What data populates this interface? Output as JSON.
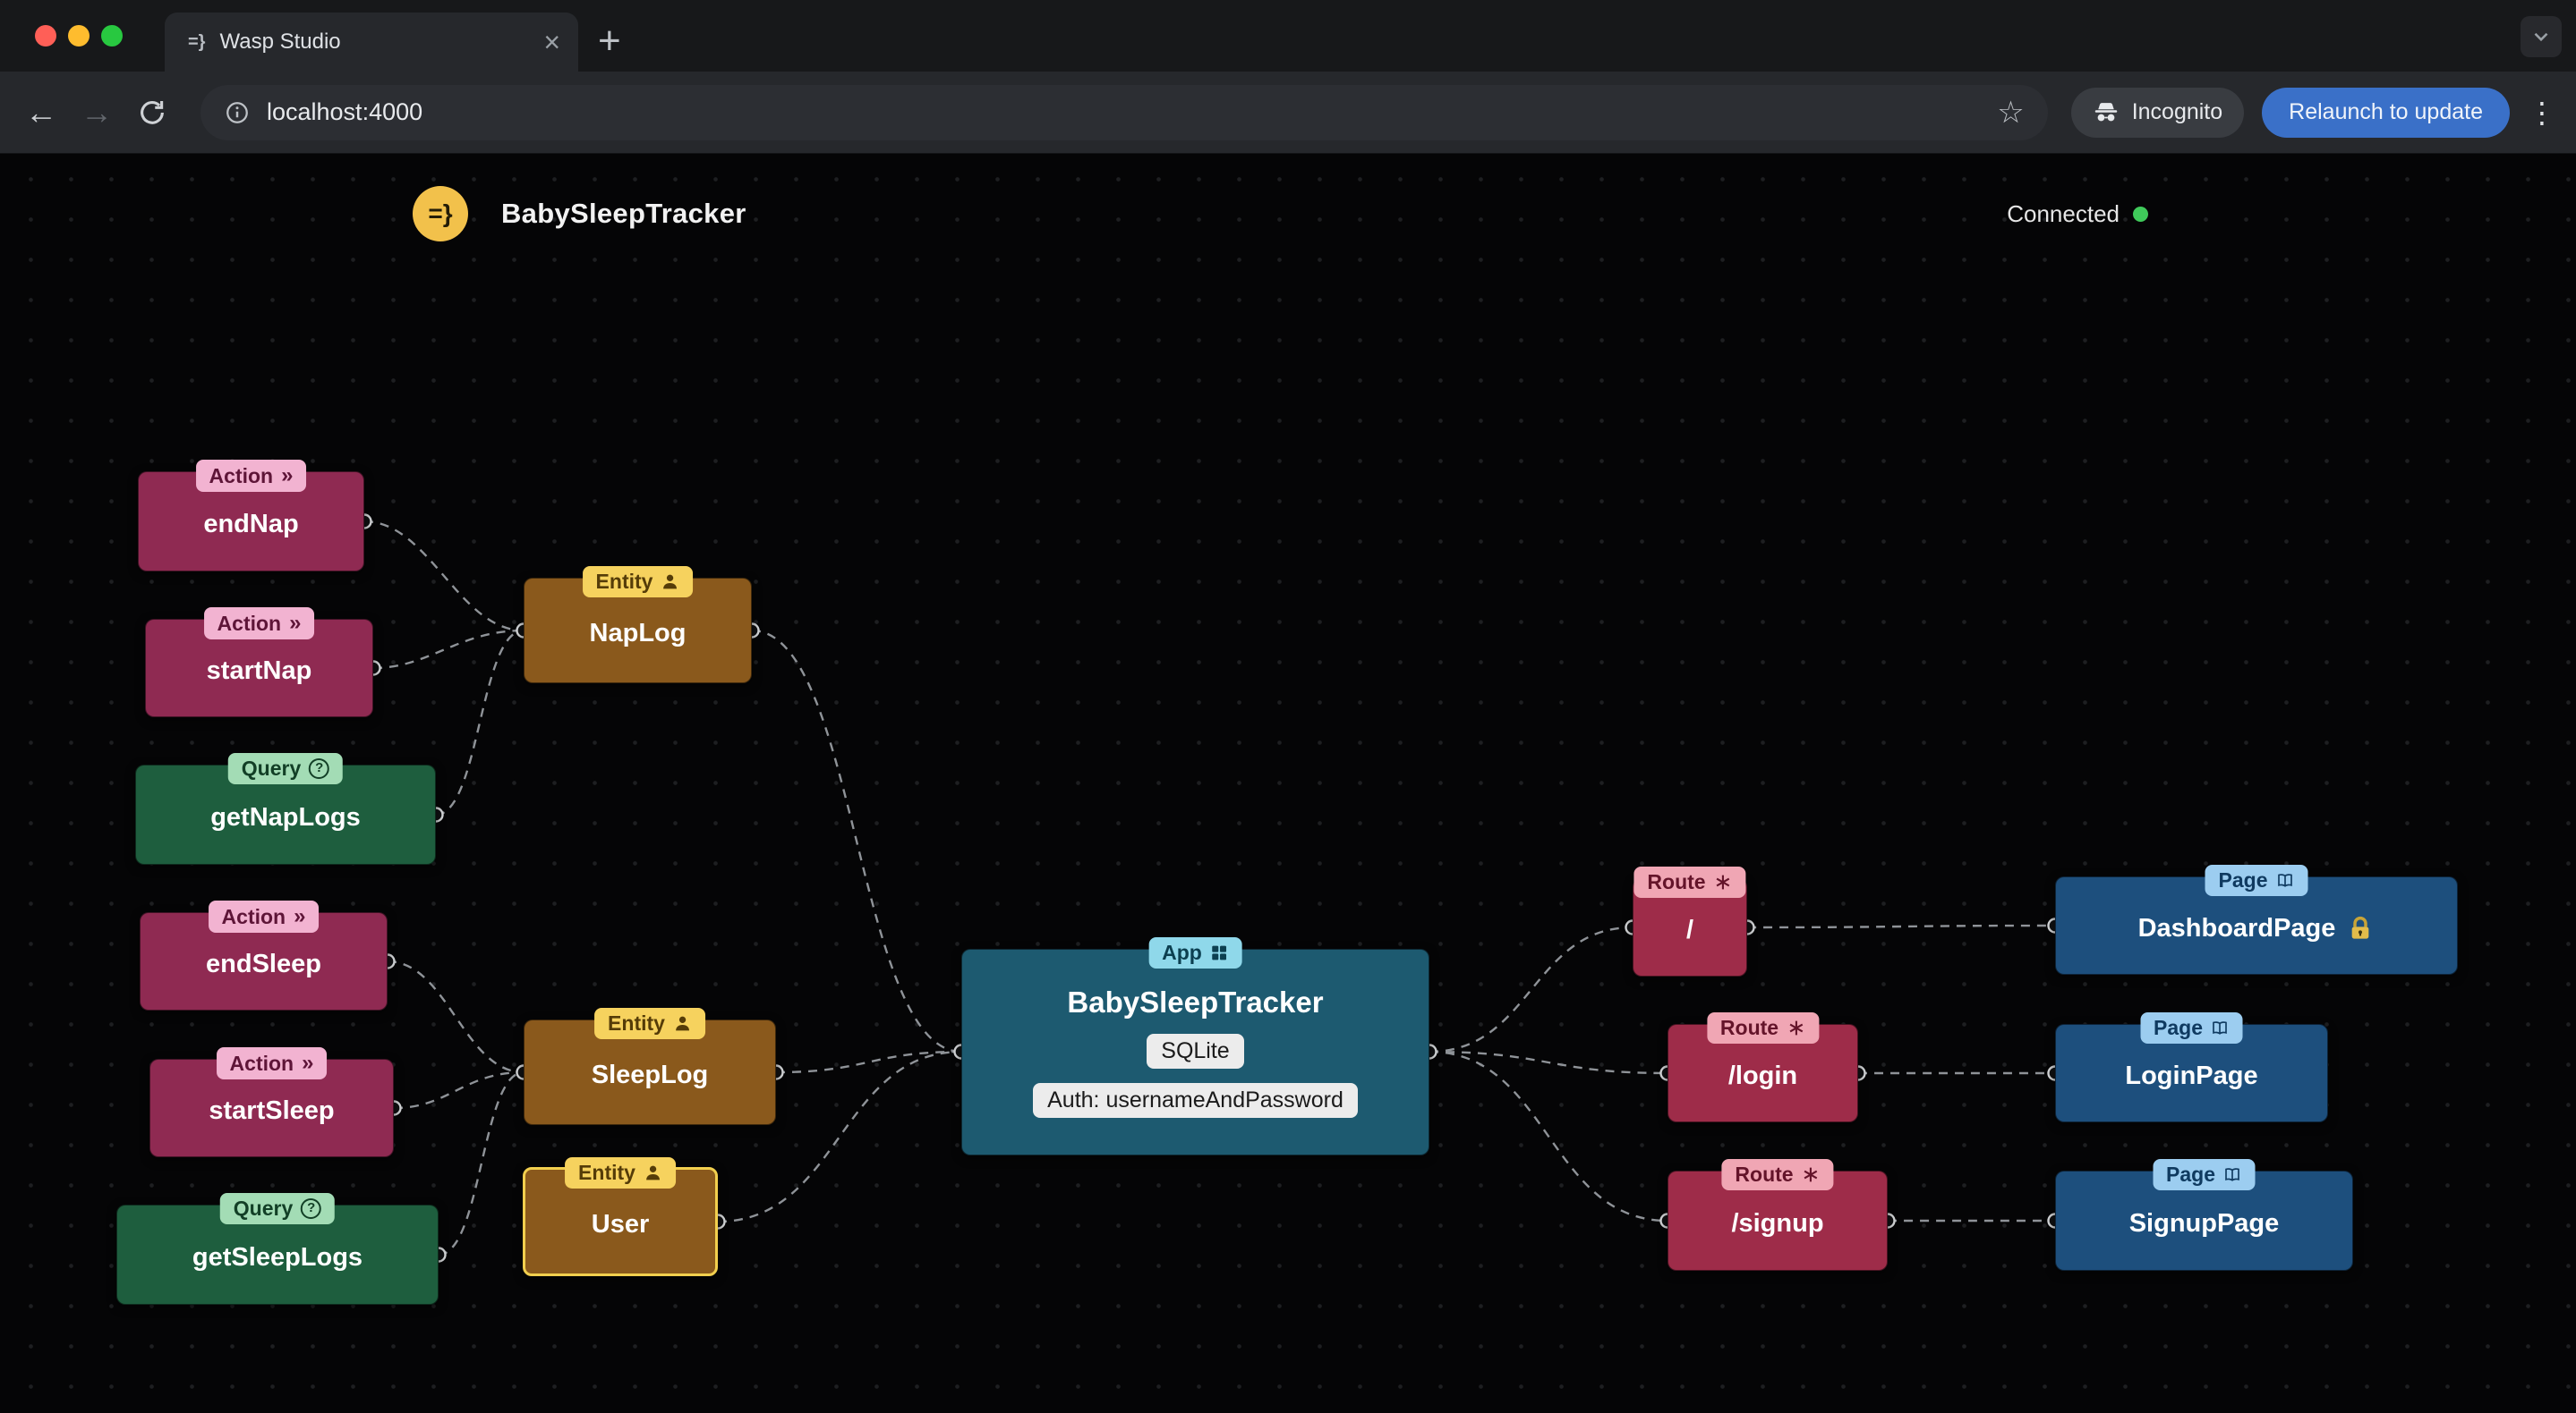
{
  "browser": {
    "tab_title": "Wasp Studio",
    "url": "localhost:4000",
    "incognito_label": "Incognito",
    "relaunch_button": "Relaunch to update"
  },
  "header": {
    "logo_glyph": "=}",
    "title": "BabySleepTracker",
    "status": "Connected"
  },
  "icons": {
    "tab_favicon": "=}",
    "close": "×",
    "new_tab": "+",
    "back": "←",
    "forward": "→",
    "menu": "⋮",
    "bookmark": "☆",
    "action_badge": "»",
    "query_badge": "?"
  },
  "nodes": {
    "endNap": {
      "type": "Action",
      "title": "endNap"
    },
    "startNap": {
      "type": "Action",
      "title": "startNap"
    },
    "getNapLogs": {
      "type": "Query",
      "title": "getNapLogs"
    },
    "endSleep": {
      "type": "Action",
      "title": "endSleep"
    },
    "startSleep": {
      "type": "Action",
      "title": "startSleep"
    },
    "getSleepLogs": {
      "type": "Query",
      "title": "getSleepLogs"
    },
    "napLog": {
      "type": "Entity",
      "title": "NapLog"
    },
    "sleepLog": {
      "type": "Entity",
      "title": "SleepLog"
    },
    "user": {
      "type": "Entity",
      "title": "User"
    },
    "app": {
      "type": "App",
      "title": "BabySleepTracker",
      "db": "SQLite",
      "auth": "Auth: usernameAndPassword"
    },
    "routeRoot": {
      "type": "Route",
      "title": "/"
    },
    "routeLogin": {
      "type": "Route",
      "title": "/login"
    },
    "routeSignup": {
      "type": "Route",
      "title": "/signup"
    },
    "dashboardPage": {
      "type": "Page",
      "title": "DashboardPage"
    },
    "loginPage": {
      "type": "Page",
      "title": "LoginPage"
    },
    "signupPage": {
      "type": "Page",
      "title": "SignupPage"
    }
  },
  "edges": [
    {
      "from": "endNap",
      "to": "NapLog"
    },
    {
      "from": "startNap",
      "to": "NapLog"
    },
    {
      "from": "getNapLogs",
      "to": "NapLog"
    },
    {
      "from": "endSleep",
      "to": "SleepLog"
    },
    {
      "from": "startSleep",
      "to": "SleepLog"
    },
    {
      "from": "getSleepLogs",
      "to": "SleepLog"
    },
    {
      "from": "NapLog",
      "to": "BabySleepTracker"
    },
    {
      "from": "SleepLog",
      "to": "BabySleepTracker"
    },
    {
      "from": "User",
      "to": "BabySleepTracker"
    },
    {
      "from": "BabySleepTracker",
      "to": "/"
    },
    {
      "from": "BabySleepTracker",
      "to": "/login"
    },
    {
      "from": "BabySleepTracker",
      "to": "/signup"
    },
    {
      "from": "/",
      "to": "DashboardPage"
    },
    {
      "from": "/login",
      "to": "LoginPage"
    },
    {
      "from": "/signup",
      "to": "SignupPage"
    }
  ],
  "colors": {
    "action_bg": "#8f2a52",
    "action_badge": "#f2b3d1",
    "query_bg": "#1e5e3e",
    "query_badge": "#a3dcb5",
    "entity_bg": "#8a591c",
    "entity_badge": "#f6d25e",
    "app_bg": "#1d5a70",
    "app_badge": "#8fd8ea",
    "route_bg": "#9e2c49",
    "route_badge": "#f0a6b4",
    "page_bg": "#1d4f7d",
    "page_badge": "#9ccdf0",
    "status_green": "#3fca5a",
    "relaunch_blue": "#3a70c8",
    "wasp_yellow": "#f2c14b",
    "canvas_bg": "#050506"
  }
}
